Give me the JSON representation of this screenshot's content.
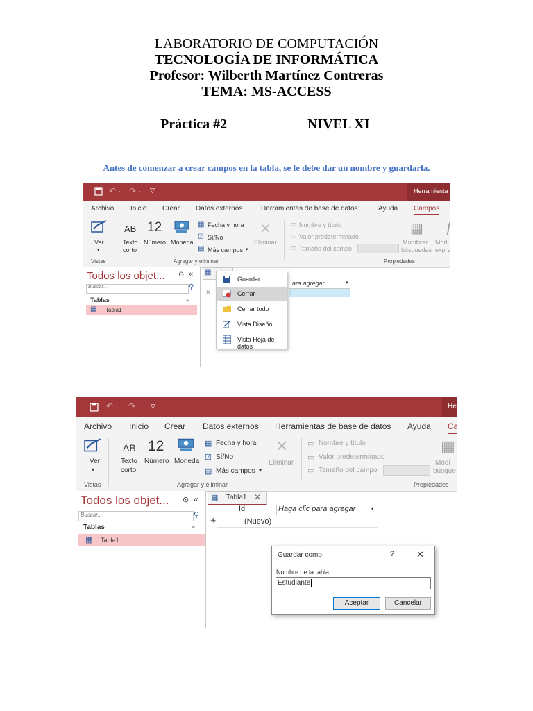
{
  "doc": {
    "line1": "LABORATORIO DE COMPUTACIÓN",
    "line2": "TECNOLOGÍA DE INFORMÁTICA",
    "line3": "Profesor: Wilberth Martínez Contreras",
    "line4": "TEMA: MS-ACCESS",
    "practica": "Práctica #2",
    "nivel": "NIVEL XI",
    "intro": "Antes de comenzar a crear campos en la tabla, se le debe dar un nombre y guardarla."
  },
  "shot1": {
    "titlebar_right": "Herramienta",
    "tabs": [
      "Archivo",
      "Inicio",
      "Crear",
      "Datos externos",
      "Herramientas de base de datos",
      "Ayuda",
      "Campos"
    ],
    "ribbon": {
      "ver": "Ver",
      "ab": "AB",
      "texto": "Texto",
      "corto": "corto",
      "num_icon": "12",
      "numero": "Número",
      "moneda": "Moneda",
      "fecha": "Fecha y hora",
      "sino": "Sí/No",
      "mas": "Más campos",
      "eliminar": "Eliminar",
      "nombre": "Nombre y título",
      "valor": "Valor predeterminado",
      "tamano": "Tamaño del campo",
      "modificar": "Modificar",
      "busquedas": "búsquedas",
      "modi2": "Modi",
      "expre": "expre",
      "vistas": "Vistas",
      "agregar": "Agregar y eliminar",
      "propiedades": "Propiedades"
    },
    "nav_title": "Todos los objet...",
    "search_placeholder": "Buscar...",
    "tablas": "Tablas",
    "tabla1": "Tabla1",
    "col_header": "ara agregar",
    "context_menu": [
      "Guardar",
      "Cerrar",
      "Cerrar todo",
      "Vista Diseño",
      "Vista Hoja de datos"
    ]
  },
  "shot2": {
    "titlebar_right": "He",
    "tabs": [
      "Archivo",
      "Inicio",
      "Crear",
      "Datos externos",
      "Herramientas de base de datos",
      "Ayuda",
      "Ca"
    ],
    "ribbon": {
      "ver": "Ver",
      "ab": "AB",
      "texto": "Texto",
      "corto": "corto",
      "num_icon": "12",
      "numero": "Número",
      "moneda": "Moneda",
      "fecha": "Fecha y hora",
      "sino": "Sí/No",
      "mas": "Más campos",
      "eliminar": "Eliminar",
      "nombre": "Nombre y título",
      "valor": "Valor predeterminado",
      "tamano": "Tamaño del campo",
      "modi": "Modi",
      "busque": "búsque",
      "vistas": "Vistas",
      "agregar": "Agregar y eliminar",
      "propiedades": "Propiedades"
    },
    "nav_title": "Todos los objet...",
    "search_placeholder": "Buscar...",
    "tablas": "Tablas",
    "tabla1": "Tabla1",
    "doc_tab": "Tabla1",
    "col_id": "Id",
    "col_add": "Haga clic para agregar",
    "new_row": "(Nuevo)",
    "dialog": {
      "title": "Guardar como",
      "help": "?",
      "label": "Nombre de la tabla:",
      "value": "Estudiante",
      "ok": "Aceptar",
      "cancel": "Cancelar"
    }
  }
}
